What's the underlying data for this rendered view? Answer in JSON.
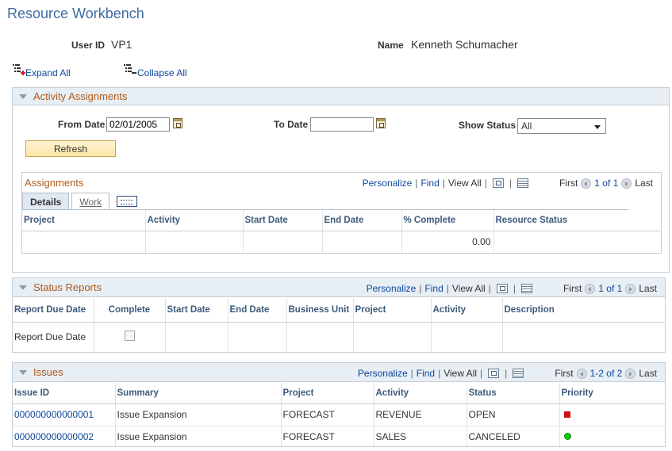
{
  "page": {
    "title": "Resource Workbench"
  },
  "header": {
    "user_id_label": "User ID",
    "user_id_value": "VP1",
    "name_label": "Name",
    "name_value": "Kenneth Schumacher"
  },
  "toolbar": {
    "expand_all": "Expand All",
    "collapse_all": "Collapse All"
  },
  "grid_nav": {
    "personalize": "Personalize",
    "find": "Find",
    "view_all": "View All",
    "first": "First",
    "last": "Last"
  },
  "activity": {
    "title": "Activity Assignments",
    "from_date_label": "From Date",
    "from_date_value": "02/01/2005",
    "to_date_label": "To Date",
    "to_date_value": "",
    "show_status_label": "Show Status",
    "show_status_value": "All",
    "refresh_label": "Refresh",
    "assignments": {
      "title": "Assignments",
      "page_count": "1 of 1",
      "tabs": [
        "Details",
        "Work"
      ],
      "columns": [
        "Project",
        "Activity",
        "Start Date",
        "End Date",
        "% Complete",
        "Resource Status"
      ],
      "rows": [
        {
          "project": "",
          "activity": "",
          "start": "",
          "end": "",
          "complete": "0.00",
          "status": ""
        }
      ]
    }
  },
  "status_reports": {
    "title": "Status Reports",
    "page_count": "1 of 1",
    "columns": [
      "Report Due Date",
      "Complete",
      "Start Date",
      "End Date",
      "Business Unit",
      "Project",
      "Activity",
      "Description"
    ],
    "rows": [
      {
        "report_due_date": "Report Due Date",
        "complete": false
      }
    ]
  },
  "issues": {
    "title": "Issues",
    "page_count": "1-2 of 2",
    "columns": [
      "Issue ID",
      "Summary",
      "Project",
      "Activity",
      "Status",
      "Priority"
    ],
    "rows": [
      {
        "id": "000000000000001",
        "summary": "Issue Expansion",
        "project": "FORECAST",
        "activity": "REVENUE",
        "status": "OPEN",
        "priority": "high",
        "priority_color": "#cc1111"
      },
      {
        "id": "000000000000002",
        "summary": "Issue Expansion",
        "project": "FORECAST",
        "activity": "SALES",
        "status": "CANCELED",
        "priority": "low",
        "priority_color": "#11cc11"
      }
    ]
  }
}
